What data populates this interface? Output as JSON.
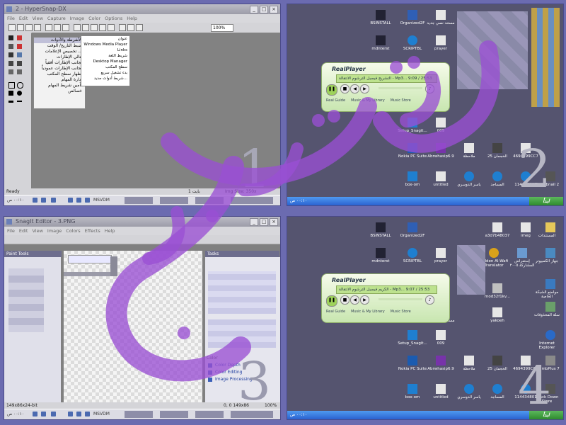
{
  "watermark": {
    "color": "#9a4fd4"
  },
  "q1": {
    "title": "2 - HyperSnap-DX",
    "menu": [
      "File",
      "Edit",
      "View",
      "Capture",
      "Image",
      "Color",
      "Options",
      "Help"
    ],
    "zoom": "100%",
    "menu_header": "الأشرطة والأدوات",
    "menu_items": [
      "ضبط التاريخ/ الوقت",
      "تخصيص الإعلامات ...",
      "تتالي الإطارات",
      "تجانب الإطارات أفقياً",
      "تجانب الإطارات عمودياً",
      "إظهار سطح المكتب",
      "إدارة المهام",
      "تأمين شريط المهام",
      "خصائص"
    ],
    "submenu_items": [
      "عنوان",
      "Windows Media Player",
      "Links",
      "شريط اللغة",
      "Desktop Manager",
      "سطح المكتب",
      "بدء تشغيل سريع",
      "شريط أدوات جديد..."
    ],
    "status_left": "Ready",
    "status_right": "Img Size: 350x",
    "status_extra": "1 بايت",
    "taskbar_item": "MSVDM",
    "clock": "٠٠:١٠ ص",
    "number": "1"
  },
  "q2": {
    "icons": [
      "BSINSTALL",
      "Organized2F",
      "مستند نصي جديد",
      "mdnterst",
      "SCRIPTBL",
      "prayer",
      "ID-DX",
      "Setup_Snagit...",
      "009",
      "Nokia PC Suite",
      "Abrwhasip6.9",
      "ملاحظة",
      "الخجمان 25",
      "4694399CC7",
      "box-om",
      "untitled",
      "ياسر الدوسري",
      "المساجد",
      "114434801",
      "Thumbnail 2"
    ],
    "player": {
      "brand": "RealPlayer",
      "now_playing": "التشريح فيسبل الترشوم الانتقالة - Mp3... 9:09 / 25:53",
      "foot": [
        "Real Guide",
        "Music & My Library",
        "Music Store"
      ]
    },
    "start": "ابدأ",
    "clock": "٠٠:١٠ ص",
    "number": "2"
  },
  "q3": {
    "title": "SnagIt Editor - 3.PNG",
    "menu": [
      "File",
      "Edit",
      "View",
      "Image",
      "Colors",
      "Effects",
      "Help"
    ],
    "left_panel": "Paint Tools",
    "right_panel": "Tasks",
    "tasks_header": "Color",
    "tasks": [
      "Color Depth",
      "Color Editing",
      "Image Processing"
    ],
    "status_left": "149x86x24-bit",
    "status_right": "0, 0  149x86",
    "status_zoom": "100%",
    "taskbar_item": "MSVDM",
    "clock": "٠٠:١٠ ص",
    "number": "3"
  },
  "q4": {
    "icons": [
      "BSINSTALL",
      "Organized2F",
      "a3d7b48037",
      "imeg",
      "المستندات",
      "mdnterst",
      "SCRIPTBL",
      "prayer",
      "Golden Al-Wafi Translator",
      "إستعراض المشاركة ٢٠٠٥",
      "جهاز الكمبيوتر",
      "mod32f1kv...",
      "مواضع الشبكة الخاصة",
      "مستند نصي جديد",
      "yakoeh",
      "سلة المحذوفات",
      "Setup_Snagit...",
      "009",
      "Internet Explorer",
      "Nokia PC Suite",
      "Abrwhasip6.9",
      "ملاحظة",
      "الخجمان 25",
      "4694399CC7",
      "ThumbPlus 7",
      "box-om",
      "untitled",
      "ياسر الدوسري",
      "المساجد",
      "114434801",
      "Crack Down Store"
    ],
    "player": {
      "brand": "RealPlayer",
      "now_playing": "الكريم فيسبل الترشوم الانتقالة - Mp3... 9:07 / 25:53",
      "foot": [
        "Real Guide",
        "Music & My Library",
        "Music Store"
      ]
    },
    "start": "ابدأ",
    "clock": "٠٠:١٠ ص",
    "number": "4"
  }
}
